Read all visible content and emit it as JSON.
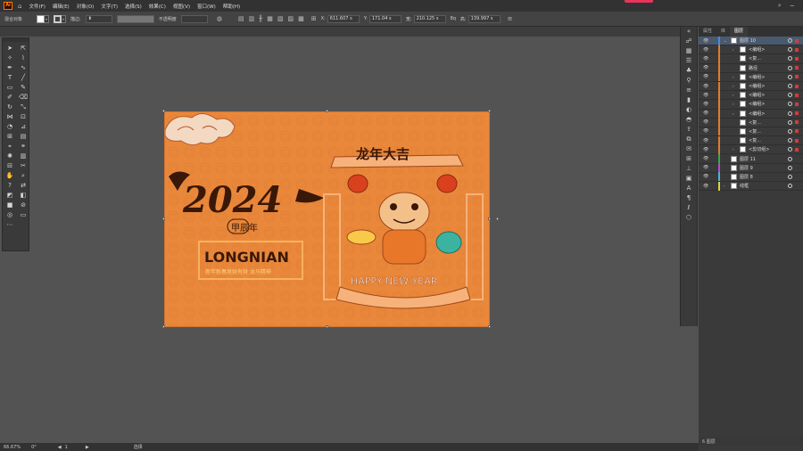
{
  "app": {
    "logo": "Ai"
  },
  "menu": [
    "文件(F)",
    "编辑(E)",
    "对象(O)",
    "文字(T)",
    "选择(S)",
    "效果(C)",
    "视图(V)",
    "窗口(W)",
    "帮助(H)"
  ],
  "control": {
    "selection_label": "混合对象",
    "stroke_label": "描边:",
    "opacity_label": "不透明度",
    "x_label": "X:",
    "x": "611.607 s",
    "y_label": "Y:",
    "y": "171.04 s",
    "w_label": "宽:",
    "w": "210.125 s",
    "h_label": "高:",
    "h": "139.997 s",
    "link_label": "8q"
  },
  "artwork": {
    "year_text": "2024",
    "jiachen": "甲辰年",
    "longnian": "LONGNIAN",
    "blessing": "新年新春发财有财 龙马精神",
    "banner": "龙年大吉",
    "happy_new_year": "HAPPY NEW YEAR"
  },
  "layers_panel": {
    "tabs": [
      "属性",
      "库",
      "图层"
    ],
    "active_tab": 2,
    "rows": [
      {
        "name": "图层 10",
        "level": 0,
        "selected": true,
        "color": "#4a8bd6",
        "arrow": "open"
      },
      {
        "name": "<编组>",
        "level": 2,
        "color": "#e37a2a",
        "arrow": "closed"
      },
      {
        "name": "<复...",
        "level": 2,
        "color": "#e37a2a",
        "arrow": ""
      },
      {
        "name": "路径",
        "level": 2,
        "color": "#e37a2a",
        "arrow": ""
      },
      {
        "name": "<编组>",
        "level": 2,
        "color": "#e37a2a",
        "arrow": "closed"
      },
      {
        "name": "<编组>",
        "level": 2,
        "color": "#e37a2a",
        "arrow": "closed"
      },
      {
        "name": "<编组>",
        "level": 2,
        "color": "#e37a2a",
        "arrow": "closed"
      },
      {
        "name": "<编组>",
        "level": 2,
        "color": "#e37a2a",
        "arrow": "closed"
      },
      {
        "name": "<编组>",
        "level": 2,
        "color": "#e37a2a",
        "arrow": "closed"
      },
      {
        "name": "<复...",
        "level": 2,
        "color": "#e37a2a",
        "arrow": ""
      },
      {
        "name": "<复...",
        "level": 2,
        "color": "#e37a2a",
        "arrow": ""
      },
      {
        "name": "<复...",
        "level": 2,
        "color": "#e37a2a",
        "arrow": ""
      },
      {
        "name": "<剪切组>",
        "level": 2,
        "color": "#e37a2a",
        "arrow": "closed"
      },
      {
        "name": "图层 11",
        "level": 0,
        "color": "#3aa84a",
        "arrow": ""
      },
      {
        "name": "图层 9",
        "level": 0,
        "color": "#b44ad6",
        "arrow": ""
      },
      {
        "name": "图层 8",
        "level": 0,
        "color": "#4ab4d6",
        "arrow": ""
      },
      {
        "name": "线框",
        "level": 0,
        "color": "#d6d63a",
        "arrow": "closed"
      }
    ],
    "footer": "6 图层"
  },
  "status": {
    "zoom": "66.67%",
    "rotate": "0°",
    "page": "1",
    "mode": "选择"
  }
}
